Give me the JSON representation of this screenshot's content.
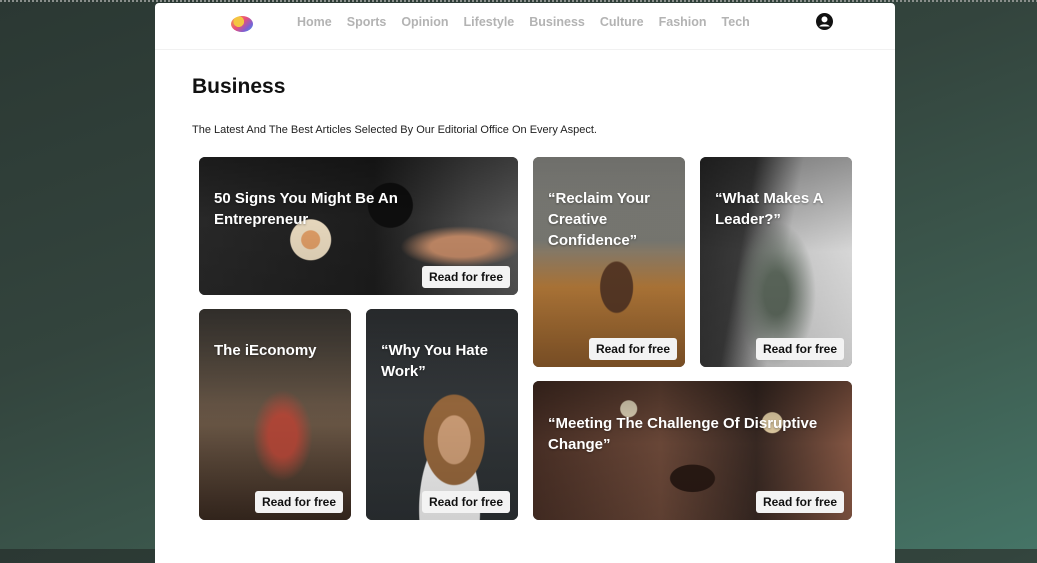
{
  "nav": {
    "items": [
      "Home",
      "Sports",
      "Opinion",
      "Lifestyle",
      "Business",
      "Culture",
      "Fashion",
      "Tech"
    ]
  },
  "section": {
    "title": "Business",
    "subtitle": "The Latest And The Best Articles Selected By Our Editorial Office On Every Aspect."
  },
  "cards": [
    {
      "title": "50 Signs You Might Be An Entrepreneur",
      "cta": "Read for free"
    },
    {
      "title": "“Reclaim Your Creative Confidence”",
      "cta": "Read for free"
    },
    {
      "title": "“What Makes A Leader?”",
      "cta": "Read for free"
    },
    {
      "title": "The iEconomy",
      "cta": "Read for free"
    },
    {
      "title": "“Why You Hate Work”",
      "cta": "Read for free"
    },
    {
      "title": "“Meeting The Challenge Of Disruptive Change”",
      "cta": "Read for free"
    }
  ],
  "icons": {
    "logo": "logo-mark",
    "user": "user-avatar-icon"
  }
}
